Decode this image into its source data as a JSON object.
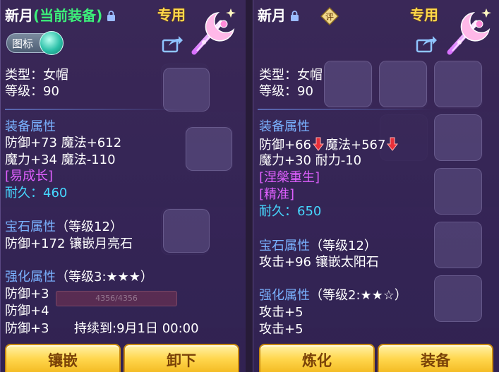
{
  "left_panel": {
    "name": "新月",
    "equip_status": "(当前装备)",
    "exclusive": "专用",
    "marker_label": "图标",
    "type_line": "类型：女帽",
    "level_line": "等级：90",
    "equip_attr_title": "装备属性",
    "equip_attr_lines": [
      "防御+73 魔法+612",
      "魔力+34 魔法-110"
    ],
    "special_tag": "[易成长]",
    "durability": "耐久：460",
    "gem_title": "宝石属性",
    "gem_level": "（等级12）",
    "gem_line": "防御+172 镶嵌月亮石",
    "enhance_title": "强化属性",
    "enhance_level": "（等级3:★★★）",
    "enhance_lines": [
      "防御+3",
      "防御+4",
      "防御+3"
    ],
    "enhance_duration": "持续到:9月1日 00:00",
    "buttons": [
      "镶嵌",
      "卸下"
    ]
  },
  "right_panel": {
    "name": "新月",
    "exclusive": "专用",
    "rate_badge": "评",
    "type_line": "类型：女帽",
    "level_line": "等级：90",
    "equip_attr_title": "装备属性",
    "attr_line1_a": "防御+66",
    "attr_line1_b": "魔法+567",
    "attr_line2": "魔力+30 耐力-10",
    "special_tags": [
      "[涅槃重生]",
      "[精准]"
    ],
    "durability": "耐久：650",
    "gem_title": "宝石属性",
    "gem_level": "（等级12）",
    "gem_line": "攻击+96 镶嵌太阳石",
    "enhance_title": "强化属性",
    "enhance_level": "（等级2:★★☆）",
    "enhance_lines": [
      "攻击+5",
      "攻击+5"
    ],
    "buttons": [
      "炼化",
      "装备"
    ]
  },
  "background": {
    "bar_text": "4356/4356"
  },
  "colors": {
    "section": "#7ab2ff",
    "equipped": "#3cf07a",
    "special": "#e060ff",
    "durability": "#46d8ff",
    "exclusive": "#ffd84a",
    "decrease_arrow": "#e8303a"
  }
}
